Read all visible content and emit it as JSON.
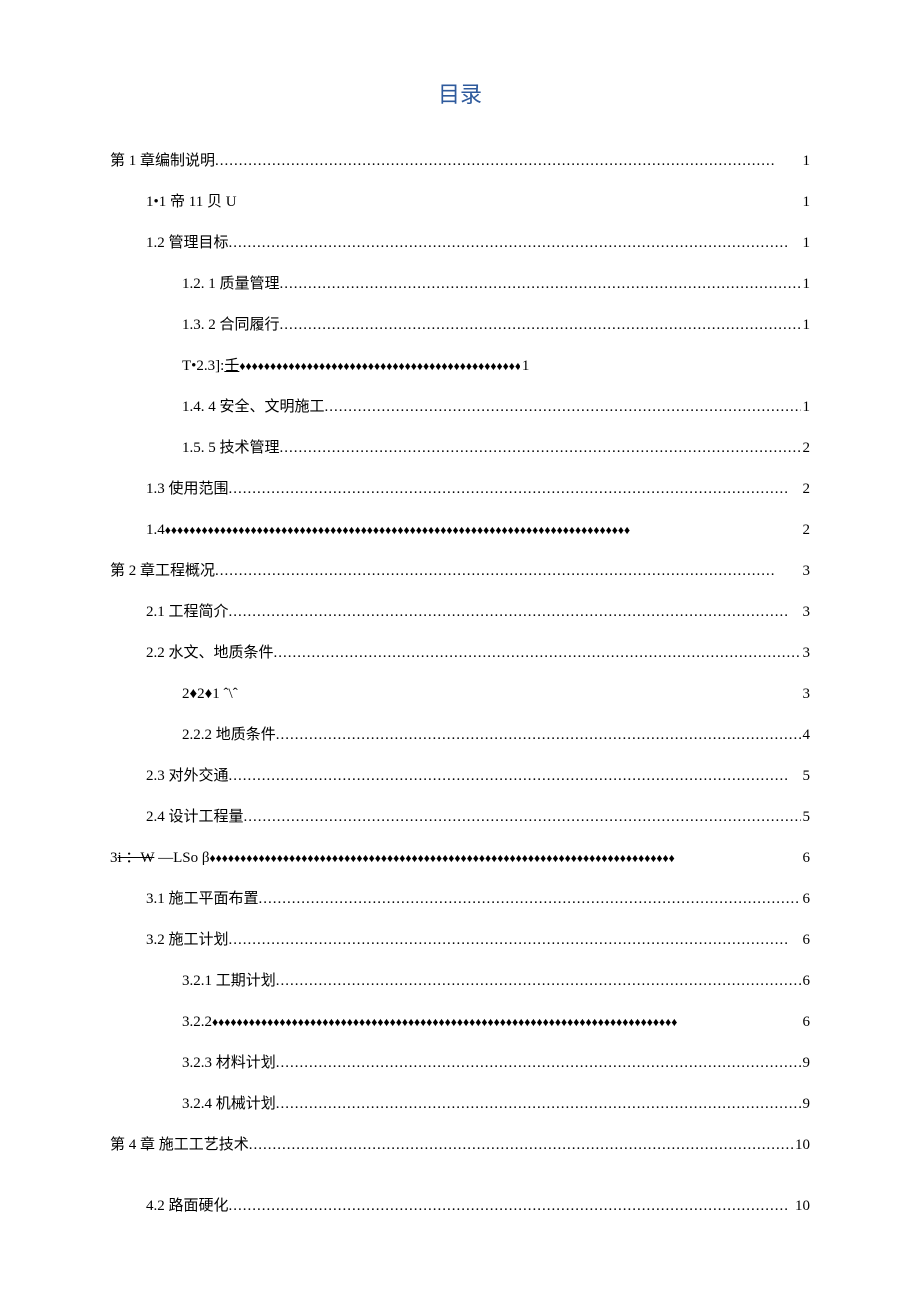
{
  "title": "目录",
  "entries": {
    "c1": {
      "label": "第 1 章编制说明",
      "page": "1"
    },
    "c1_1": {
      "label": "1•1 帝 11 贝 U",
      "page": "1"
    },
    "c1_2": {
      "label": "1.2  管理目标",
      "page": "1"
    },
    "c1_2_1": {
      "label": "1.2. 1 质量管理 ",
      "page": "1"
    },
    "c1_3_2": {
      "label": "1.3. 2 合同履行 ",
      "page": "1"
    },
    "c1_2_3a": {
      "label_pre": "T•2.3]:",
      "label_u": "壬",
      "page": "1"
    },
    "c1_4_4": {
      "label": "1.4. 4 安全、文明施工 ",
      "page": "1"
    },
    "c1_5_5": {
      "label": "1.5. 5 技术管理 ",
      "page": "2"
    },
    "c1_3": {
      "label": "1.3  使用范围",
      "page": "2"
    },
    "c1_4": {
      "label": "1.4  ",
      "page": "2"
    },
    "c2": {
      "label": "第 2 章工程概况",
      "page": "3"
    },
    "c2_1": {
      "label": "2.1 工程简介",
      "page": "3"
    },
    "c2_2": {
      "label": "2.2 水文、地质条件",
      "page": "3"
    },
    "c2_2_1": {
      "label": "2♦2♦1       ˆ\\ˆ",
      "page": "3"
    },
    "c2_2_2": {
      "label": "2.2.2 地质条件 ",
      "page": "4"
    },
    "c2_3": {
      "label": "2.3 对外交通",
      "page": "5"
    },
    "c2_4": {
      "label": "2.4 设计工程量",
      "page": "5"
    },
    "c3": {
      "label_a": "3",
      "label_b": "i ：W",
      "label_c": " —LSo β ",
      "page": "6"
    },
    "c3_1": {
      "label": "3.1 施工平面布置",
      "page": "6"
    },
    "c3_2": {
      "label": "3.2 施工计划",
      "page": "6"
    },
    "c3_2_1": {
      "label": "3.2.1 工期计划 ",
      "page": "6"
    },
    "c3_2_2": {
      "label": "3.2.2          ",
      "page": "6"
    },
    "c3_2_3": {
      "label": "3.2.3 材料计划 ",
      "page": "9"
    },
    "c3_2_4": {
      "label": "3.2.4 机械计划 ",
      "page": "9"
    },
    "c4": {
      "label": "第 4 章   施工工艺技术 ",
      "page": "10"
    },
    "c4_2": {
      "label": "4.2 路面硬化",
      "page": "10"
    }
  }
}
